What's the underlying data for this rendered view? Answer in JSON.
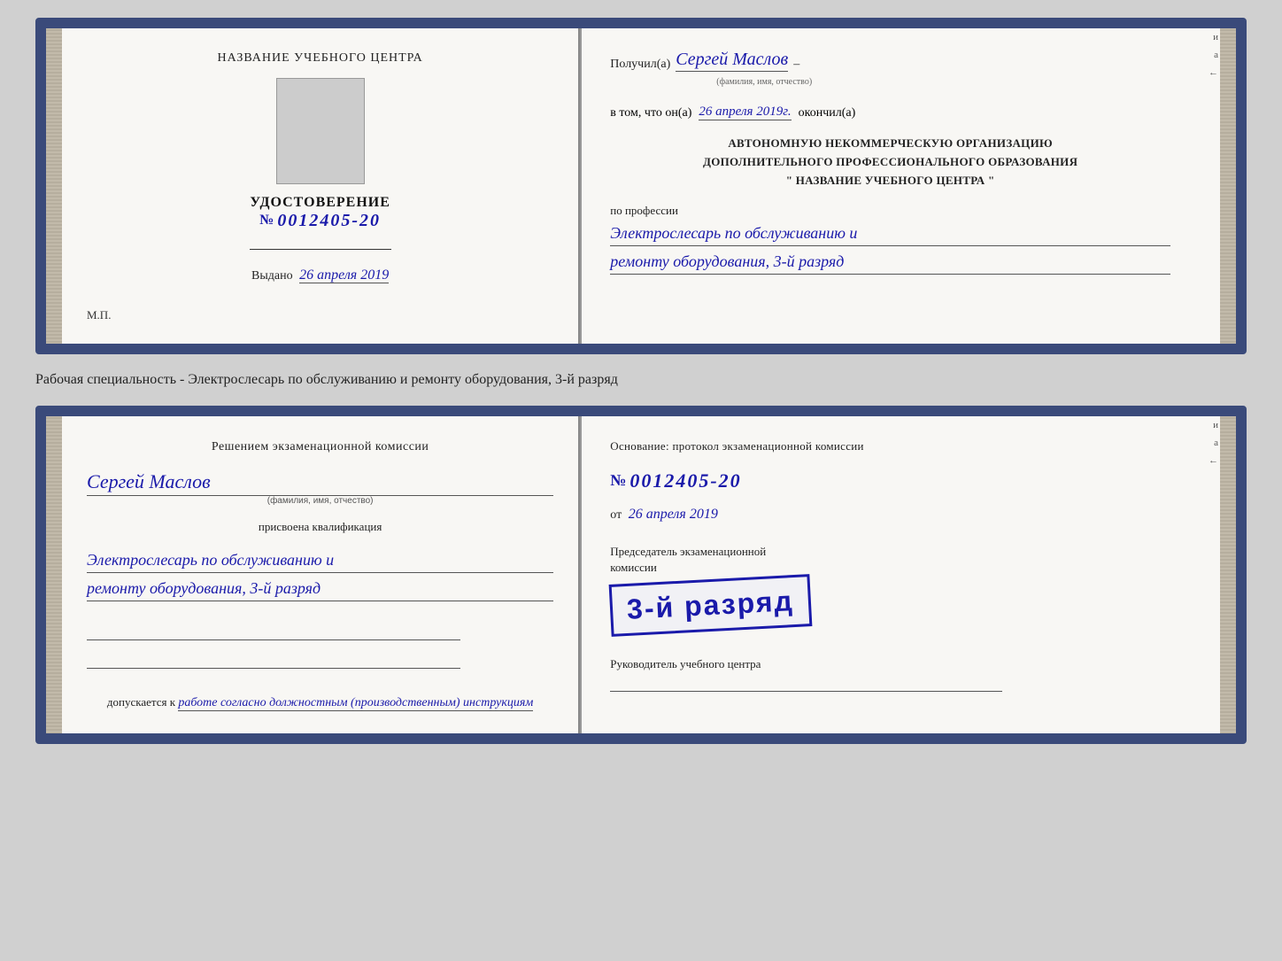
{
  "top_card": {
    "left": {
      "center_title": "НАЗВАНИЕ УЧЕБНОГО ЦЕНТРА",
      "photo_alt": "фото",
      "cert_label": "УДОСТОВЕРЕНИЕ",
      "cert_number_prefix": "№",
      "cert_number": "0012405-20",
      "sig_line": "",
      "issued_label": "Выдано",
      "issued_date": "26 апреля 2019",
      "mp_label": "М.П."
    },
    "right": {
      "received_label": "Получил(а)",
      "person_name": "Сергей Маслов",
      "person_name_sublabel": "(фамилия, имя, отчество)",
      "dash": "–",
      "in_that_label": "в том, что он(а)",
      "date_value": "26 апреля 2019г.",
      "finished_label": "окончил(а)",
      "org_line1": "АВТОНОМНУЮ НЕКОММЕРЧЕСКУЮ ОРГАНИЗАЦИЮ",
      "org_line2": "ДОПОЛНИТЕЛЬНОГО ПРОФЕССИОНАЛЬНОГО ОБРАЗОВАНИЯ",
      "org_line3": "\"    НАЗВАНИЕ УЧЕБНОГО ЦЕНТРА    \"",
      "profession_label": "по профессии",
      "profession_line1": "Электрослесарь по обслуживанию и",
      "profession_line2": "ремонту оборудования, 3-й разряд"
    }
  },
  "caption": {
    "text": "Рабочая специальность - Электрослесарь по обслуживанию и ремонту оборудования, 3-й разряд"
  },
  "bottom_card": {
    "left": {
      "decision_title": "Решением экзаменационной комиссии",
      "person_name": "Сергей Маслов",
      "person_name_sublabel": "(фамилия, имя, отчество)",
      "assigned_label": "присвоена квалификация",
      "qual_line1": "Электрослесарь по обслуживанию и",
      "qual_line2": "ремонту оборудования, 3-й разряд",
      "allowed_label": "допускается к",
      "allowed_hw": "работе согласно должностным (производственным) инструкциям"
    },
    "right": {
      "basis_label": "Основание: протокол экзаменационной комиссии",
      "number_prefix": "№",
      "number_value": "0012405-20",
      "date_prefix": "от",
      "date_value": "26 апреля 2019",
      "stamp_small1": "Председатель экзаменационной",
      "stamp_small2": "комиссии",
      "stamp_big": "3-й разряд",
      "head_label": "Руководитель учебного центра"
    }
  }
}
